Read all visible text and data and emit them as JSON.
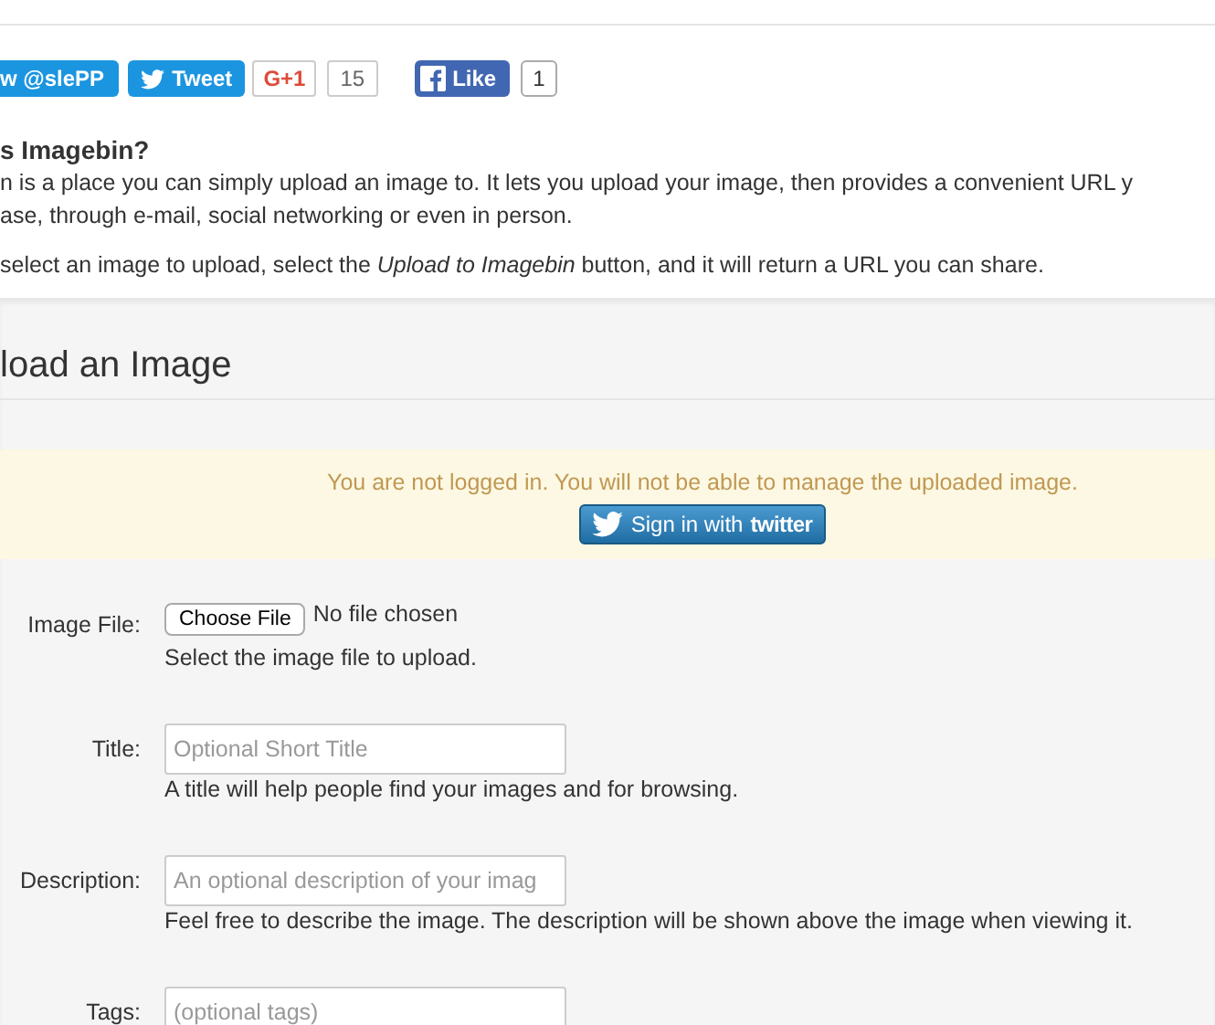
{
  "social": {
    "follow": "w @slePP",
    "tweet": "Tweet",
    "gplus": "G+1",
    "gplus_count": "15",
    "like": "Like",
    "like_count": "1"
  },
  "about": {
    "heading": "s Imagebin?",
    "lines": [
      "n is a place you can simply upload an image to. It lets you upload your image, then provides a convenient URL y",
      "ase, through e-mail, social networking or even in person."
    ],
    "instruction": "select an image to upload, select the *Upload to Imagebin* button, and it will return a URL you can share."
  },
  "upload": {
    "heading": "load an Image",
    "alert": "You are not logged in. You will not be able to manage the uploaded image.",
    "signin": "Sign in with",
    "signin_brand": "twitter",
    "fields": [
      {
        "kind": "file",
        "label": "Image File:",
        "button": "Choose File",
        "status": "No file chosen",
        "help": "Select the image file to upload."
      },
      {
        "kind": "text",
        "label": "Title:",
        "placeholder": "Optional Short Title",
        "help": "A title will help people find your images and for browsing."
      },
      {
        "kind": "text",
        "label": "Description:",
        "placeholder": "An optional description of your imag",
        "help": "Feel free to describe the image. The description will be shown above the image when viewing it."
      },
      {
        "kind": "text",
        "label": "Tags:",
        "placeholder": "(optional tags)"
      }
    ]
  }
}
